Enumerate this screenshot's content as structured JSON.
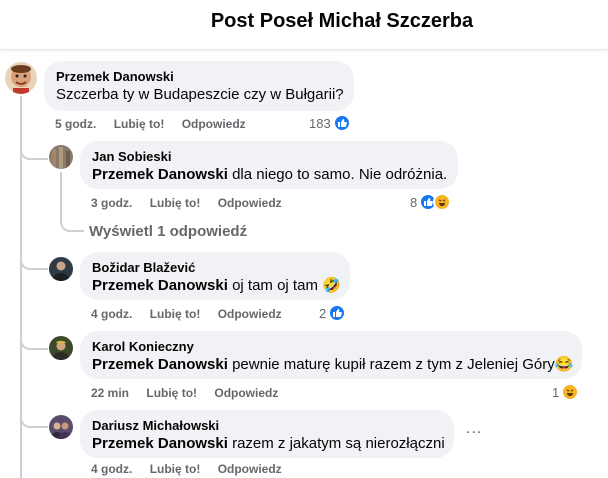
{
  "header": {
    "title": "Post Poseł Michał Szczerba"
  },
  "main_comment": {
    "author": "Przemek Danowski",
    "text": "Szczerba ty w Budapeszcie czy w Bułgarii?",
    "time": "5 godz.",
    "like": "Lubię to!",
    "reply": "Odpowiedz",
    "reaction_count": "183",
    "reactions": [
      "like-icon"
    ]
  },
  "replies": [
    {
      "author": "Jan Sobieski",
      "mention": "Przemek Danowski",
      "text": "dla niego to samo. Nie odróżnia.",
      "time": "3 godz.",
      "like": "Lubię to!",
      "reply": "Odpowiedz",
      "reaction_count": "8",
      "reactions": [
        "like-icon",
        "haha-icon"
      ]
    },
    {
      "author": "Božidar Blažević",
      "mention": "Przemek Danowski",
      "text": "oj tam oj tam 🤣",
      "time": "4 godz.",
      "like": "Lubię to!",
      "reply": "Odpowiedz",
      "reaction_count": "2",
      "reactions": [
        "like-icon"
      ]
    },
    {
      "author": "Karol Konieczny",
      "mention": "Przemek Danowski",
      "text": "pewnie maturę kupił razem z tym z Jeleniej Góry😂",
      "time": "22 min",
      "like": "Lubię to!",
      "reply": "Odpowiedz",
      "reaction_count": "1",
      "reactions": [
        "haha-icon"
      ]
    },
    {
      "author": "Dariusz Michałowski",
      "mention": "Przemek Danowski",
      "text": "razem z jakatym są nierozłączni",
      "time": "4 godz.",
      "like": "Lubię to!",
      "reply": "Odpowiedz",
      "more": "..."
    }
  ],
  "nested_more": {
    "label": "Wyświetl 1 odpowiedź"
  },
  "colors": {
    "like": "#1877f2",
    "haha": "#f7b125",
    "bubble": "#f0f2f5",
    "muted": "#65676b"
  }
}
